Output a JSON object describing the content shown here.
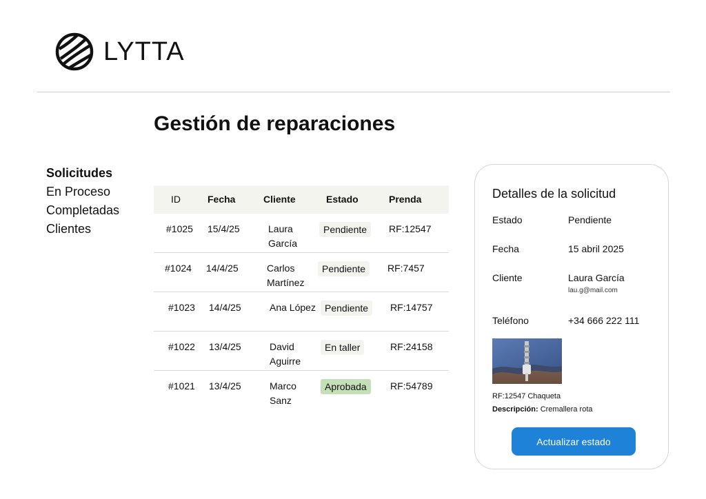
{
  "brand": {
    "name": "LYTTA"
  },
  "page": {
    "title": "Gestión de reparaciones"
  },
  "sidebar": {
    "items": [
      {
        "label": "Solicitudes",
        "active": true
      },
      {
        "label": "En Proceso",
        "active": false
      },
      {
        "label": "Completadas",
        "active": false
      },
      {
        "label": "Clientes",
        "active": false
      }
    ]
  },
  "table": {
    "headers": {
      "id": "ID",
      "date": "Fecha",
      "client": "Cliente",
      "status": "Estado",
      "garment": "Prenda"
    },
    "rows": [
      {
        "id": "#1025",
        "date": "15/4/25",
        "client": "Laura García",
        "status": "Pendiente",
        "garment": "RF:12547"
      },
      {
        "id": "#1024",
        "date": "14/4/25",
        "client": "Carlos Martínez",
        "status": "Pendiente",
        "garment": "RF:7457"
      },
      {
        "id": "#1023",
        "date": "14/4/25",
        "client": "Ana López",
        "status": "Pendiente",
        "garment": "RF:14757"
      },
      {
        "id": "#1022",
        "date": "13/4/25",
        "client": "David Aguirre",
        "status": "En taller",
        "garment": "RF:24158"
      },
      {
        "id": "#1021",
        "date": "13/4/25",
        "client": "Marco Sanz",
        "status": "Aprobada",
        "garment": "RF:54789"
      }
    ]
  },
  "detail": {
    "title": "Detalles de la solicitud",
    "status_label": "Estado",
    "status_value": "Pendiente",
    "date_label": "Fecha",
    "date_value": "15 abril 2025",
    "client_label": "Cliente",
    "client_value": "Laura García",
    "client_email": "lau.g@mail.com",
    "phone_label": "Teléfono",
    "phone_value": "+34 666 222 111",
    "photo_caption": "RF:12547 Chaqueta",
    "description_label": "Descripción:",
    "description_value": "Cremallera rota",
    "update_button": "Actualizar estado"
  },
  "colors": {
    "accent": "#1f82d9",
    "status_pending_bg": "#f4f4ef",
    "status_approved_bg": "#c5dfb9",
    "header_bg": "#f4f4ef"
  }
}
